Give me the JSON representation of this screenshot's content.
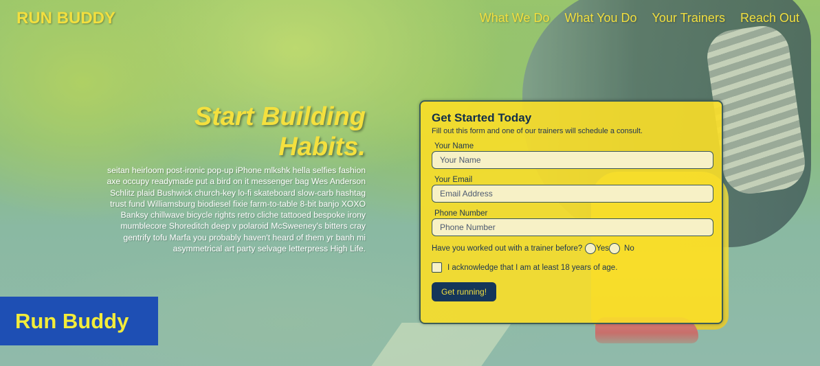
{
  "header": {
    "logo": "RUN BUDDY",
    "nav": [
      "What We Do",
      "What You Do",
      "Your Trainers",
      "Reach Out"
    ]
  },
  "hero": {
    "title_line1": "Start Building",
    "title_line2": "Habits.",
    "body": "seitan heirloom post-ironic pop-up iPhone mlkshk hella selfies fashion axe occupy readymade put a bird on it messenger bag Wes Anderson Schlitz plaid Bushwick church-key lo-fi skateboard slow-carb hashtag trust fund Williamsburg biodiesel fixie farm-to-table 8-bit banjo XOXO Banksy chillwave bicycle rights retro cliche tattooed bespoke irony mumblecore Shoreditch deep v polaroid McSweeney's bitters cray gentrify tofu Marfa you probably haven't heard of them yr banh mi asymmetrical art party selvage letterpress High Life."
  },
  "form": {
    "title": "Get Started Today",
    "subtitle": "Fill out this form and one of our trainers will schedule a consult.",
    "fields": [
      {
        "label": "Your Name",
        "placeholder": "Your Name",
        "value": ""
      },
      {
        "label": "Your Email",
        "placeholder": "Email Address",
        "value": ""
      },
      {
        "label": "Phone Number",
        "placeholder": "Phone Number",
        "value": ""
      }
    ],
    "trainer_question": "Have you worked out with a trainer before?",
    "yes_label": "Yes",
    "no_label": "No",
    "acknowledge": "I acknowledge that I am at least 18 years of age.",
    "submit_label": "Get running!"
  },
  "badge": {
    "text": "Run Buddy"
  },
  "colors": {
    "accent_yellow": "#f2df3f",
    "form_bg": "#fade28",
    "button_bg": "#15365a",
    "badge_bg": "#1e4fb4"
  }
}
